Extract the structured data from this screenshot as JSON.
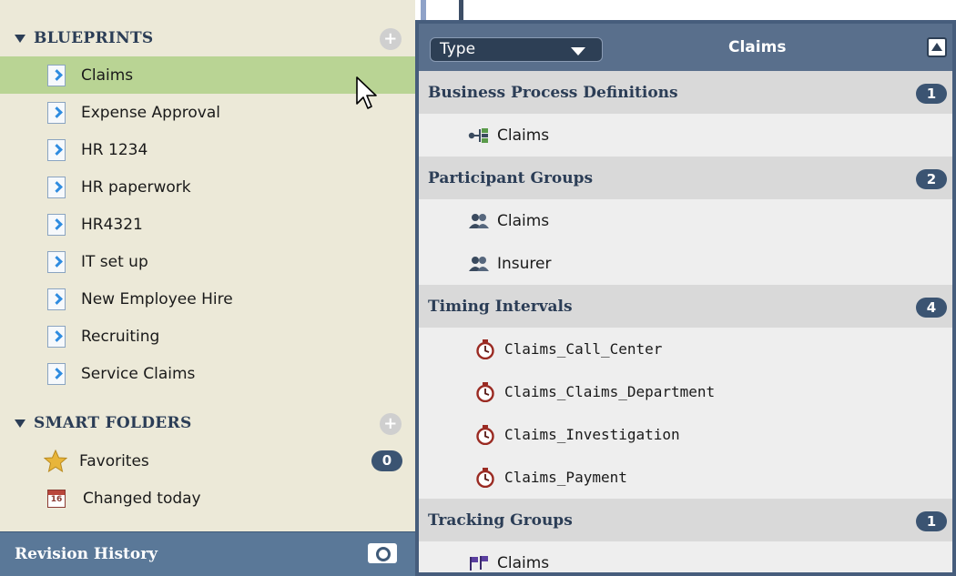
{
  "sidebar": {
    "blueprints_header": "BLUEPRINTS",
    "blueprints": [
      {
        "label": "Claims",
        "selected": true
      },
      {
        "label": "Expense Approval"
      },
      {
        "label": "HR 1234"
      },
      {
        "label": "HR paperwork"
      },
      {
        "label": "HR4321"
      },
      {
        "label": "IT set up"
      },
      {
        "label": "New Employee Hire"
      },
      {
        "label": "Recruiting"
      },
      {
        "label": "Service Claims"
      }
    ],
    "smart_folders_header": "SMART FOLDERS",
    "smart_folders": [
      {
        "label": "Favorites",
        "badge": "0",
        "icon": "star-icon"
      },
      {
        "label": "Changed today",
        "icon": "calendar-icon",
        "calendar_day": "16"
      }
    ],
    "revision_history": "Revision History",
    "plus_symbol": "+"
  },
  "panel": {
    "type_label": "Type",
    "title": "Claims",
    "groups": [
      {
        "title": "Business Process Definitions",
        "count": "1",
        "items": [
          "Claims"
        ],
        "icon": "process-icon"
      },
      {
        "title": "Participant Groups",
        "count": "2",
        "items": [
          "Claims",
          "Insurer"
        ],
        "icon": "people-icon"
      },
      {
        "title": "Timing Intervals",
        "count": "4",
        "items": [
          "Claims_Call_Center",
          "Claims_Claims_Department",
          "Claims_Investigation",
          "Claims_Payment"
        ],
        "icon": "timer-icon"
      },
      {
        "title": "Tracking Groups",
        "count": "1",
        "items": [
          "Claims"
        ],
        "icon": "flags-icon"
      }
    ]
  },
  "colors": {
    "selected_row": "#b9d494",
    "sidebar_bg": "#ece9d8",
    "header_bar": "#596f8c",
    "badge": "#3b5472",
    "group_header": "#d9d9d9"
  }
}
